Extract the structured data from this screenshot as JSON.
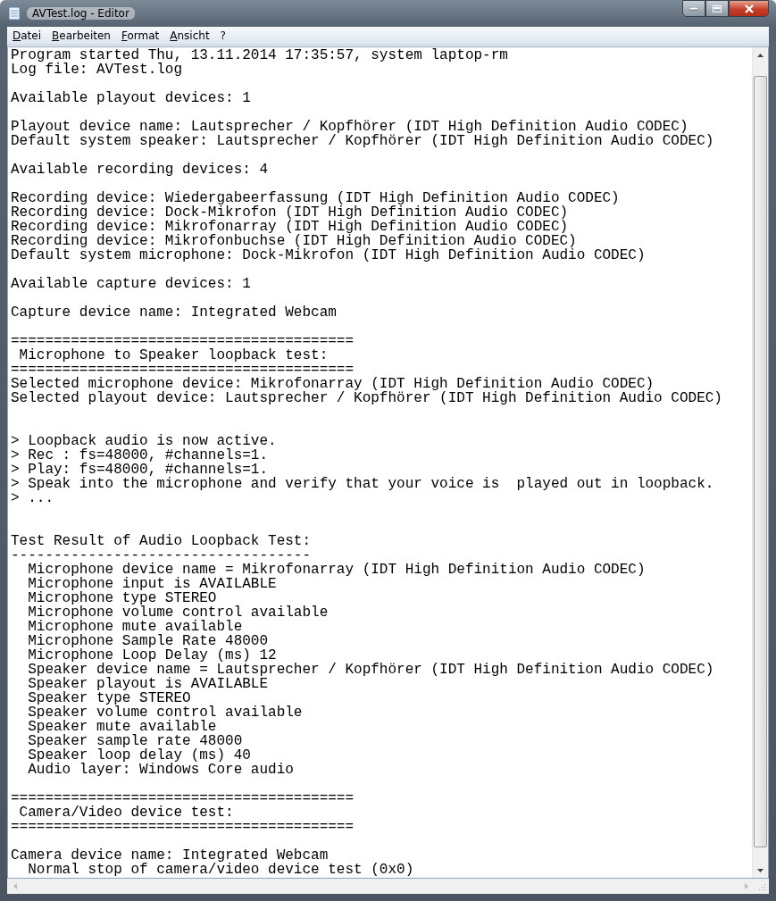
{
  "window": {
    "title": "AVTest.log - Editor"
  },
  "menu": [
    "Datei",
    "Bearbeiten",
    "Format",
    "Ansicht",
    "?"
  ],
  "sections": [
    {
      "paragraphs": [
        [
          "Program started Thu, 13.11.2014 17:35:57, system laptop-rm",
          "Log file: AVTest.log"
        ],
        [
          "Available playout devices: 1"
        ],
        [
          "Playout device name: Lautsprecher / Kopfhörer (IDT High Definition Audio CODEC)",
          "Default system speaker: Lautsprecher / Kopfhörer (IDT High Definition Audio CODEC)"
        ],
        [
          "Available recording devices: 4"
        ],
        [
          "Recording device: Wiedergabeerfassung (IDT High Definition Audio CODEC)",
          "Recording device: Dock-Mikrofon (IDT High Definition Audio CODEC)",
          "Recording device: Mikrofonarray (IDT High Definition Audio CODEC)",
          "Recording device: Mikrofonbuchse (IDT High Definition Audio CODEC)",
          "Default system microphone: Dock-Mikrofon (IDT High Definition Audio CODEC)"
        ],
        [
          "Available capture devices: 1"
        ],
        [
          "Capture device name: Integrated Webcam"
        ],
        [
          "========================================",
          " Microphone to Speaker loopback test:",
          "========================================",
          "Selected microphone device: Mikrofonarray (IDT High Definition Audio CODEC)",
          "Selected playout device: Lautsprecher / Kopfhörer (IDT High Definition Audio CODEC)"
        ]
      ]
    },
    {
      "paragraphs": [
        [
          "> Loopback audio is now active.",
          "> Rec : fs=48000, #channels=1.",
          "> Play: fs=48000, #channels=1.",
          "> Speak into the microphone and verify that your voice is  played out in loopback.",
          "> ..."
        ]
      ]
    },
    {
      "paragraphs": [
        [
          "Test Result of Audio Loopback Test:",
          "-----------------------------------",
          "  Microphone device name = Mikrofonarray (IDT High Definition Audio CODEC)",
          "  Microphone input is AVAILABLE",
          "  Microphone type STEREO",
          "  Microphone volume control available",
          "  Microphone mute available",
          "  Microphone Sample Rate 48000",
          "  Microphone Loop Delay (ms) 12",
          "  Speaker device name = Lautsprecher / Kopfhörer (IDT High Definition Audio CODEC)",
          "  Speaker playout is AVAILABLE",
          "  Speaker type STEREO",
          "  Speaker volume control available",
          "  Speaker mute available",
          "  Speaker sample rate 48000",
          "  Speaker loop delay (ms) 40",
          "  Audio layer: Windows Core audio"
        ],
        [
          "========================================",
          " Camera/Video device test:",
          "========================================"
        ],
        [
          "Camera device name: Integrated Webcam",
          "  Normal stop of camera/video device test (0x0)"
        ]
      ]
    }
  ]
}
